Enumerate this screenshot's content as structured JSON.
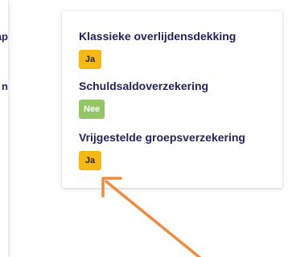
{
  "left_panel": {
    "lines": [
      "ap",
      "n"
    ]
  },
  "card": {
    "items": [
      {
        "title": "Klassieke overlijdensdekking",
        "value": "Ja",
        "status": "yes"
      },
      {
        "title": "Schuldsaldoverzekering",
        "value": "Nee",
        "status": "no"
      },
      {
        "title": "Vrijgestelde groepsverzekering",
        "value": "Ja",
        "status": "yes"
      }
    ]
  },
  "colors": {
    "title": "#24225b",
    "badge_yes": "#f6b914",
    "badge_no": "#93c765",
    "annotation_arrow": "#f08a3c"
  },
  "annotation": {
    "icon": "arrow-annotation-icon"
  }
}
